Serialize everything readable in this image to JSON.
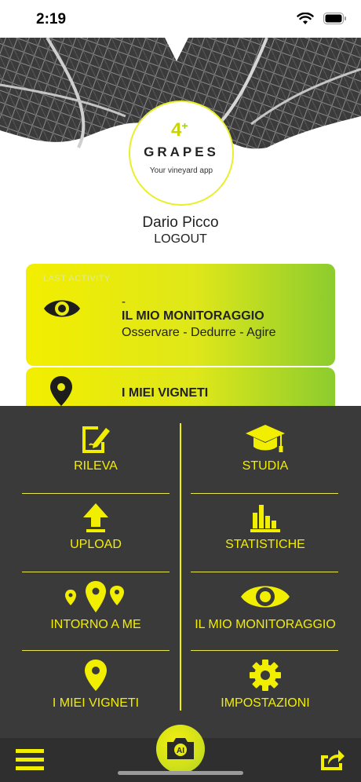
{
  "status_bar": {
    "time": "2:19"
  },
  "logo": {
    "mark": "4",
    "name": "GRAPES",
    "tagline": "Your vineyard app"
  },
  "user": {
    "name": "Dario Picco",
    "logout_label": "LOGOUT"
  },
  "cards": {
    "last_activity": {
      "overline": "LAST ACTIVITY",
      "dash": "-",
      "title": "IL MIO MONITORAGGIO",
      "subtitle": "Osservare - Dedurre - Agire",
      "icon": "eye-icon"
    },
    "vineyards": {
      "title": "I MIEI VIGNETI",
      "icon": "map-pin-icon"
    }
  },
  "menu": {
    "items": [
      {
        "label": "RILEVA",
        "icon": "edit-note-icon"
      },
      {
        "label": "STUDIA",
        "icon": "graduation-cap-icon"
      },
      {
        "label": "UPLOAD",
        "icon": "upload-arrow-icon"
      },
      {
        "label": "STATISTICHE",
        "icon": "bar-chart-icon"
      },
      {
        "label": "INTORNO A ME",
        "icon": "nearby-pins-icon"
      },
      {
        "label": "IL MIO MONITORAGGIO",
        "icon": "eye-icon"
      },
      {
        "label": "I MIEI VIGNETI",
        "icon": "map-pin-icon"
      },
      {
        "label": "IMPOSTAZIONI",
        "icon": "gear-icon"
      }
    ]
  },
  "bottom_bar": {
    "camera_label": "AI",
    "menu_icon": "hamburger-icon",
    "share_icon": "share-icon"
  },
  "colors": {
    "accent": "#f2ee00",
    "green": "#8ccc2e",
    "menu_bg": "#3a3a3a",
    "bar_bg": "#2f2f2f"
  }
}
